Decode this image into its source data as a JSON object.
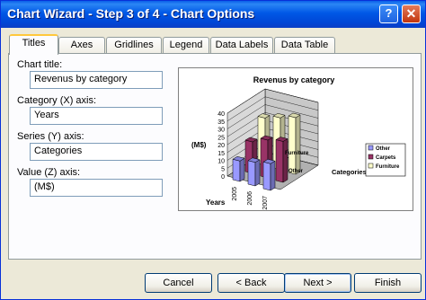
{
  "window": {
    "title": "Chart Wizard - Step 3 of 4 - Chart Options",
    "help": "?",
    "close": "✕"
  },
  "tabs": [
    {
      "label": "Titles"
    },
    {
      "label": "Axes"
    },
    {
      "label": "Gridlines"
    },
    {
      "label": "Legend"
    },
    {
      "label": "Data Labels"
    },
    {
      "label": "Data Table"
    }
  ],
  "form": {
    "chart_title_label": "Chart title:",
    "chart_title_value": "Revenus by category",
    "category_axis_label": "Category (X) axis:",
    "category_axis_value": "Years",
    "series_axis_label": "Series (Y) axis:",
    "series_axis_value": "Categories",
    "value_axis_label": "Value (Z) axis:",
    "value_axis_value": "(M$)"
  },
  "buttons": {
    "cancel": "Cancel",
    "back": "< Back",
    "next": "Next >",
    "finish": "Finish"
  },
  "chart_data": {
    "type": "bar",
    "title": "Revenus by category",
    "xlabel": "Years",
    "ylabel": "Categories",
    "zlabel": "(M$)",
    "categories": [
      "2005",
      "2006",
      "2007"
    ],
    "depth_tick_labels": [
      "Furniture",
      "Other"
    ],
    "zlim": [
      0,
      40
    ],
    "z_ticks": [
      "0",
      "5",
      "10",
      "15",
      "20",
      "25",
      "30",
      "35",
      "40"
    ],
    "series": [
      {
        "name": "Other",
        "values": [
          13,
          15,
          17
        ],
        "color": "#9999ff"
      },
      {
        "name": "Carpets",
        "values": [
          20,
          24,
          26
        ],
        "color": "#993366"
      },
      {
        "name": "Furniture",
        "values": [
          30,
          33,
          36
        ],
        "color": "#ffffcc"
      }
    ],
    "legend_position": "right",
    "view": "3d-column"
  }
}
